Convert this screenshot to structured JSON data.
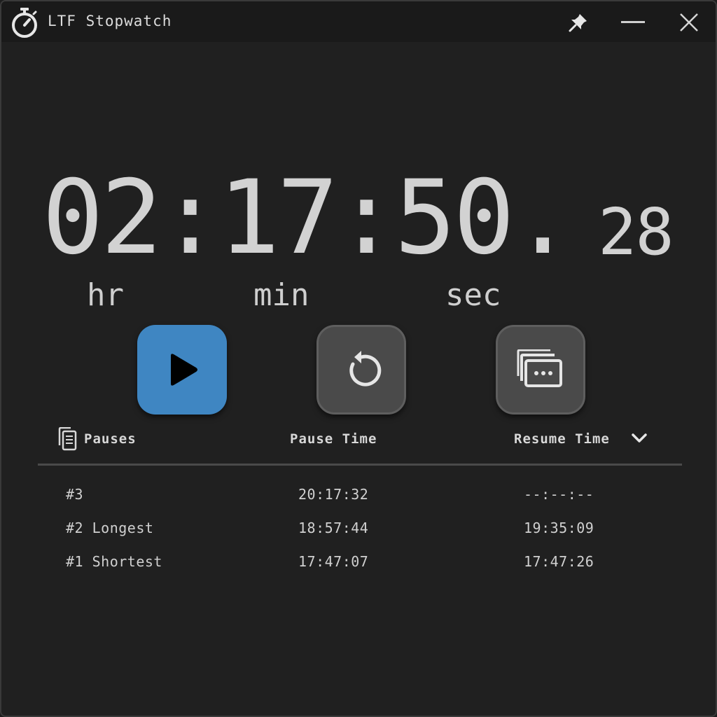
{
  "window": {
    "title": "LTF Stopwatch",
    "icons": {
      "app": "stopwatch-icon",
      "pin": "pin-icon",
      "minimize": "minimize-icon",
      "close": "close-icon"
    }
  },
  "timer": {
    "main": "02:17:50.",
    "fraction": "28",
    "units": {
      "hours": "hr",
      "minutes": "min",
      "seconds": "sec"
    }
  },
  "controls": {
    "play_icon": "play-icon",
    "reset_icon": "reset-icon",
    "laps_icon": "laps-window-icon",
    "play_color": "#3f86c2",
    "secondary_color": "#4a4a4a"
  },
  "table": {
    "headers": {
      "name": "Pauses",
      "pause_time": "Pause Time",
      "resume_time": "Resume Time"
    },
    "header_icon": "document-icon",
    "sort_icon": "chevron-down-icon",
    "rows": [
      {
        "name": "#3",
        "pause_time": "20:17:32",
        "resume_time": "--:--:--"
      },
      {
        "name": "#2 Longest",
        "pause_time": "18:57:44",
        "resume_time": "19:35:09"
      },
      {
        "name": "#1 Shortest",
        "pause_time": "17:47:07",
        "resume_time": "17:47:26"
      }
    ]
  }
}
